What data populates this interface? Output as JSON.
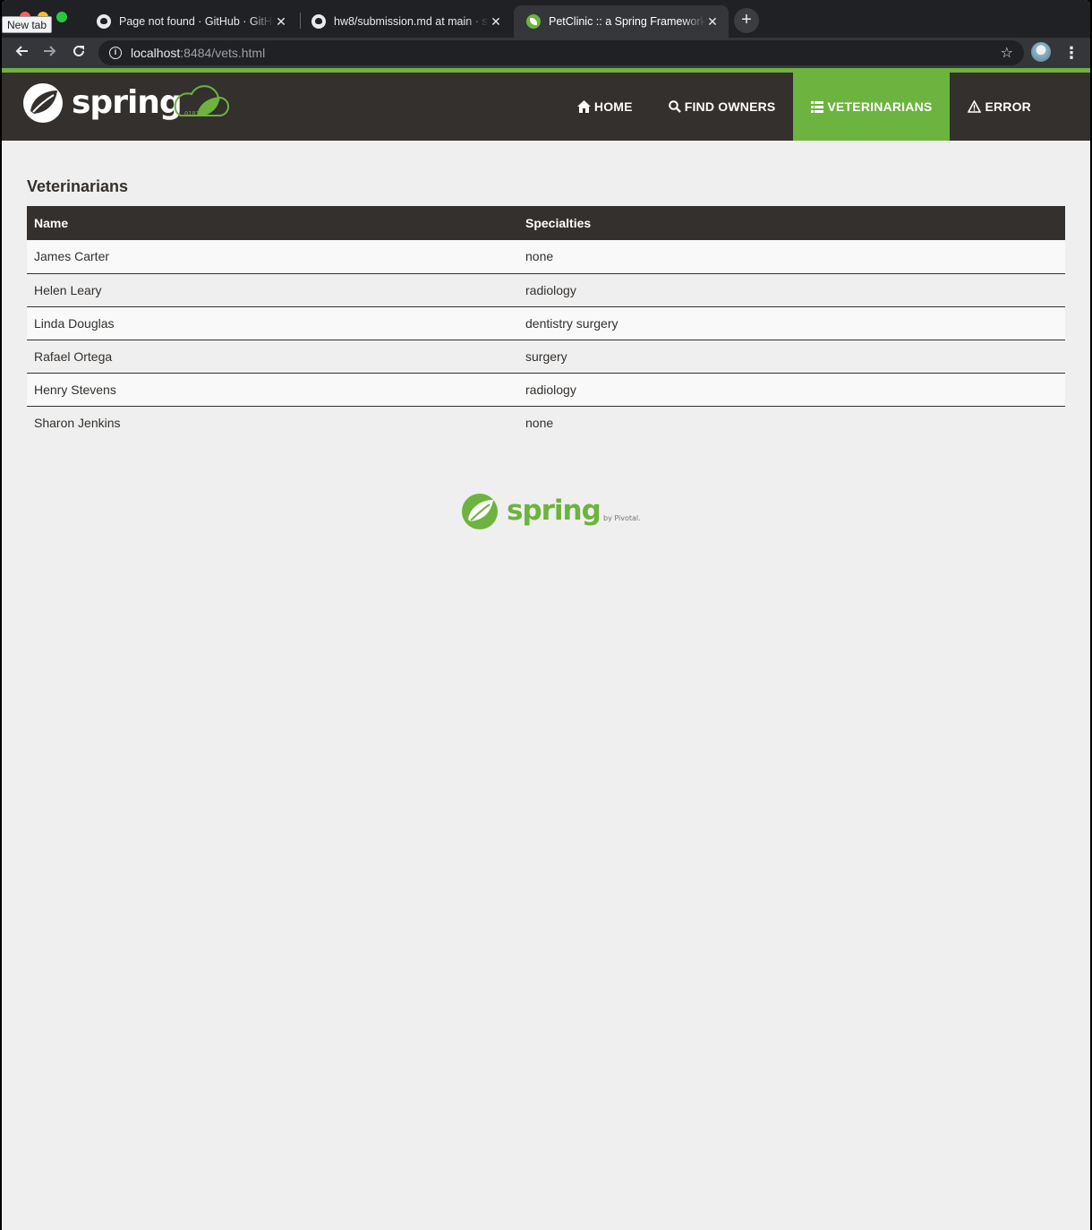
{
  "browser": {
    "tooltip": "New tab",
    "tabs": [
      {
        "title": "Page not found · GitHub · GitHub"
      },
      {
        "title": "hw8/submission.md at main · s"
      },
      {
        "title": "PetClinic :: a Spring Framework"
      }
    ],
    "close_glyph": "✕",
    "new_tab_glyph": "+",
    "url_host": "localhost",
    "url_rest": ":8484/vets.html"
  },
  "navbar": {
    "brand": "spring",
    "items": [
      {
        "label": "HOME",
        "icon": "home-icon"
      },
      {
        "label": "FIND OWNERS",
        "icon": "search-icon"
      },
      {
        "label": "VETERINARIANS",
        "icon": "list-icon"
      },
      {
        "label": "ERROR",
        "icon": "warning-icon"
      }
    ],
    "active_index": 2
  },
  "page": {
    "title": "Veterinarians",
    "table": {
      "headers": [
        "Name",
        "Specialties"
      ],
      "rows": [
        [
          "James Carter",
          "none"
        ],
        [
          "Helen Leary",
          "radiology"
        ],
        [
          "Linda Douglas",
          "dentistry surgery"
        ],
        [
          "Rafael Ortega",
          "surgery"
        ],
        [
          "Henry Stevens",
          "radiology"
        ],
        [
          "Sharon Jenkins",
          "none"
        ]
      ]
    }
  },
  "footer": {
    "logo_text": "spring",
    "byline": "by Pivotal."
  },
  "colors": {
    "spring_green": "#6db33f",
    "navbar_bg": "#34302d",
    "page_bg": "#efefef"
  }
}
